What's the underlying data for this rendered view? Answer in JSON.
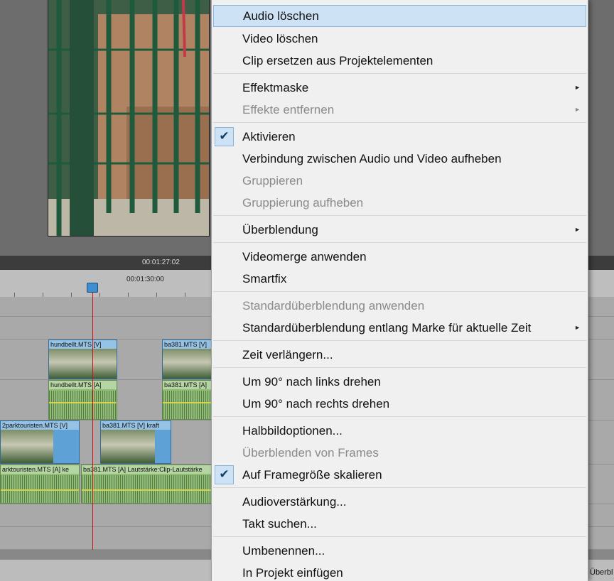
{
  "timeline": {
    "current_time": "00:01:27:02",
    "ruler_mark": "00:01:30:00",
    "clips": {
      "hund_video": "hundbellt.MTS [V]",
      "hund_audio": "hundbellt.MTS [A]",
      "ba381_video_top": "ba381.MTS [V]",
      "ba381_audio_top": "ba381.MTS [A]",
      "parkt_video": "2parktouristen.MTS [V]",
      "ba381_video_mid": "ba381.MTS [V]",
      "ba381_video_mid_tag": "kraft",
      "parkt_audio": "arktouristen.MTS [A]",
      "parkt_audio_tag": "ke",
      "ba381_audio_mid": "ba381.MTS [A]",
      "lautstaerke": "Lautstärke:Clip-Lautstärke"
    },
    "bottom_right_text": "Überbl"
  },
  "menu": {
    "items": [
      {
        "label": "Audio löschen"
      },
      {
        "label": "Video löschen"
      },
      {
        "label": "Clip ersetzen aus Projektelementen"
      },
      {
        "label": "Effektmaske"
      },
      {
        "label": "Effekte entfernen"
      },
      {
        "label": "Aktivieren"
      },
      {
        "label": "Verbindung zwischen Audio und Video aufheben"
      },
      {
        "label": "Gruppieren"
      },
      {
        "label": "Gruppierung aufheben"
      },
      {
        "label": "Überblendung"
      },
      {
        "label": "Videomerge anwenden"
      },
      {
        "label": "Smartfix"
      },
      {
        "label": "Standardüberblendung anwenden"
      },
      {
        "label": "Standardüberblendung entlang Marke für aktuelle Zeit"
      },
      {
        "label": "Zeit verlängern..."
      },
      {
        "label": "Um 90° nach links drehen"
      },
      {
        "label": "Um 90° nach rechts drehen"
      },
      {
        "label": "Halbbildoptionen..."
      },
      {
        "label": "Überblenden von Frames"
      },
      {
        "label": "Auf Framegröße skalieren"
      },
      {
        "label": "Audioverstärkung..."
      },
      {
        "label": "Takt suchen..."
      },
      {
        "label": "Umbenennen..."
      },
      {
        "label": "In Projekt einfügen"
      }
    ],
    "check_glyph": "✔",
    "submenu_glyph": "►"
  },
  "colors": {
    "highlight": "#cde3f5",
    "playhead": "#d01010",
    "video_clip": "#5ea1d6",
    "audio_clip": "#8fbf74"
  }
}
